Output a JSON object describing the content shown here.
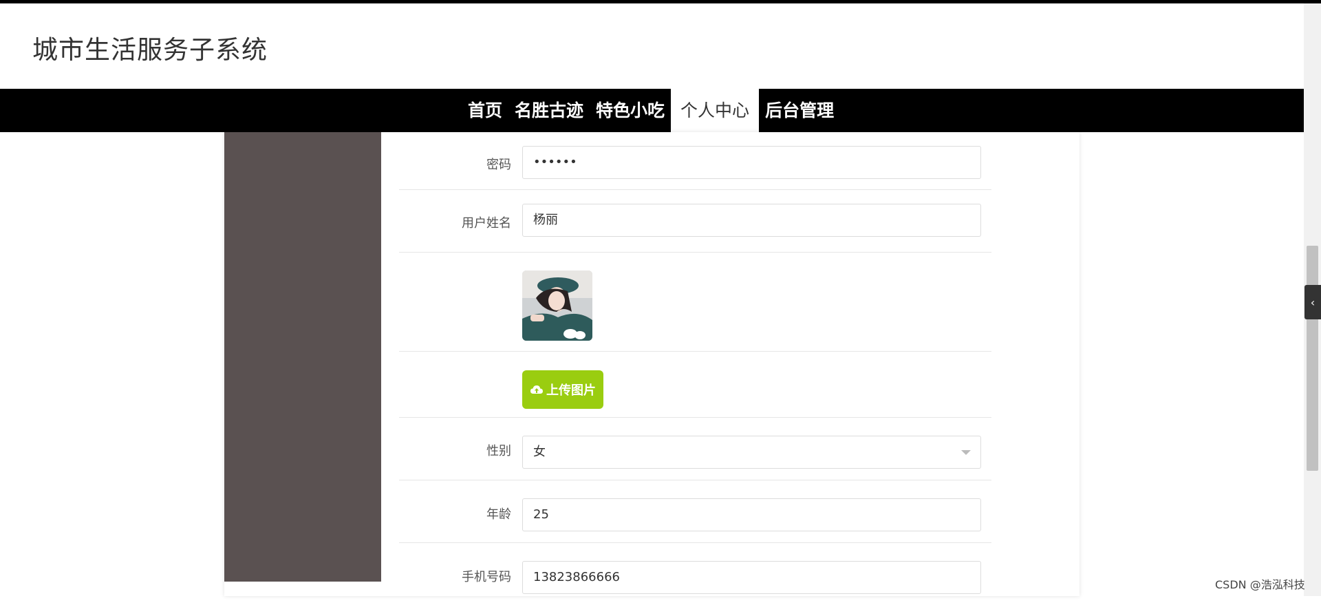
{
  "site": {
    "title": "城市生活服务子系统"
  },
  "nav": {
    "items": [
      {
        "label": "首页"
      },
      {
        "label": "名胜古迹"
      },
      {
        "label": "特色小吃"
      },
      {
        "label": "个人中心",
        "active": true
      },
      {
        "label": "后台管理"
      }
    ]
  },
  "form": {
    "password": {
      "label": "密码",
      "value": "••••••"
    },
    "username": {
      "label": "用户姓名",
      "value": "杨丽"
    },
    "upload": {
      "label": "上传图片",
      "icon": "cloud-upload-icon"
    },
    "gender": {
      "label": "性别",
      "value": "女"
    },
    "age": {
      "label": "年龄",
      "value": "25"
    },
    "phone": {
      "label": "手机号码",
      "value": "13823866666"
    }
  },
  "watermark": {
    "text": "CSDN @浩泓科技"
  },
  "colors": {
    "nav_bg": "#000000",
    "sidebar_bg": "#5a5151",
    "upload_button": "#9acd10"
  }
}
